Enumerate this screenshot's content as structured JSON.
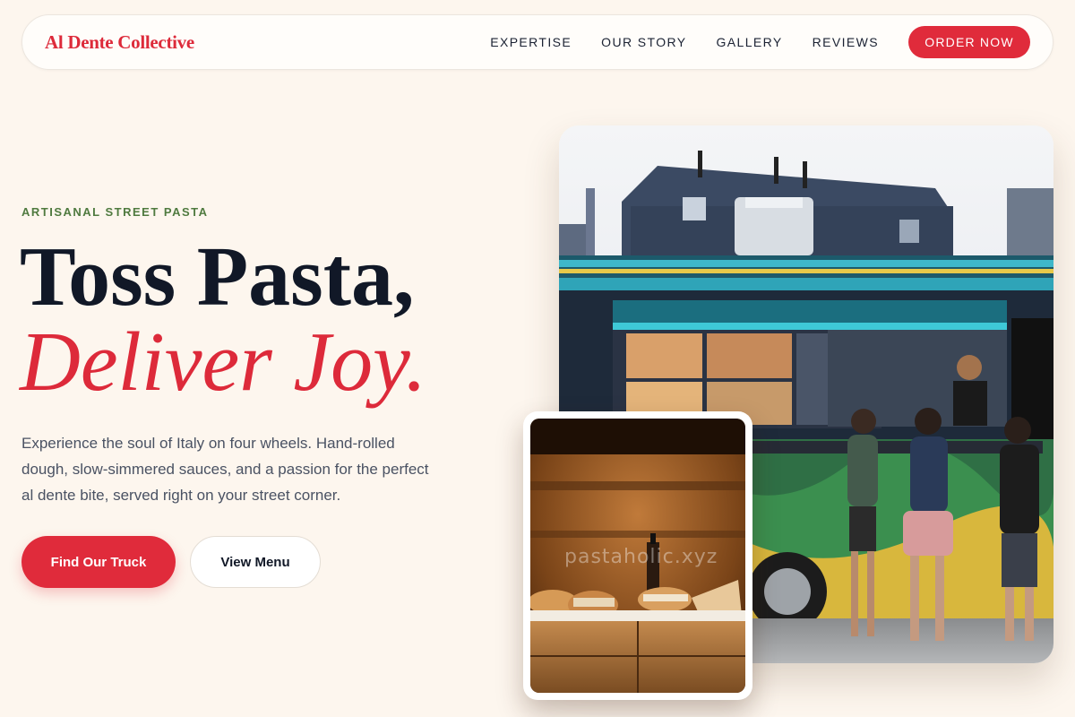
{
  "brand": {
    "name": "Al Dente Collective",
    "accent": "#e02b3b",
    "eyebrow_color": "#4f7a3f",
    "background": "#fdf6ee"
  },
  "nav": {
    "links": [
      "EXPERTISE",
      "OUR STORY",
      "GALLERY",
      "REVIEWS"
    ],
    "cta": "ORDER NOW"
  },
  "hero": {
    "eyebrow": "ARTISANAL STREET PASTA",
    "title_line1": "Toss Pasta,",
    "title_line2": "Deliver Joy.",
    "lead": "Experience the soul of Italy on four wheels. Hand-rolled dough, slow-simmered sauces, and a passion for the perfect al dente bite, served right on your street corner.",
    "primary_button": "Find Our Truck",
    "secondary_button": "View Menu"
  },
  "images": {
    "main_alt": "food truck with customers ordering",
    "secondary_alt": "sandwiches on wooden crate",
    "watermark": "pastaholic.xyz"
  }
}
